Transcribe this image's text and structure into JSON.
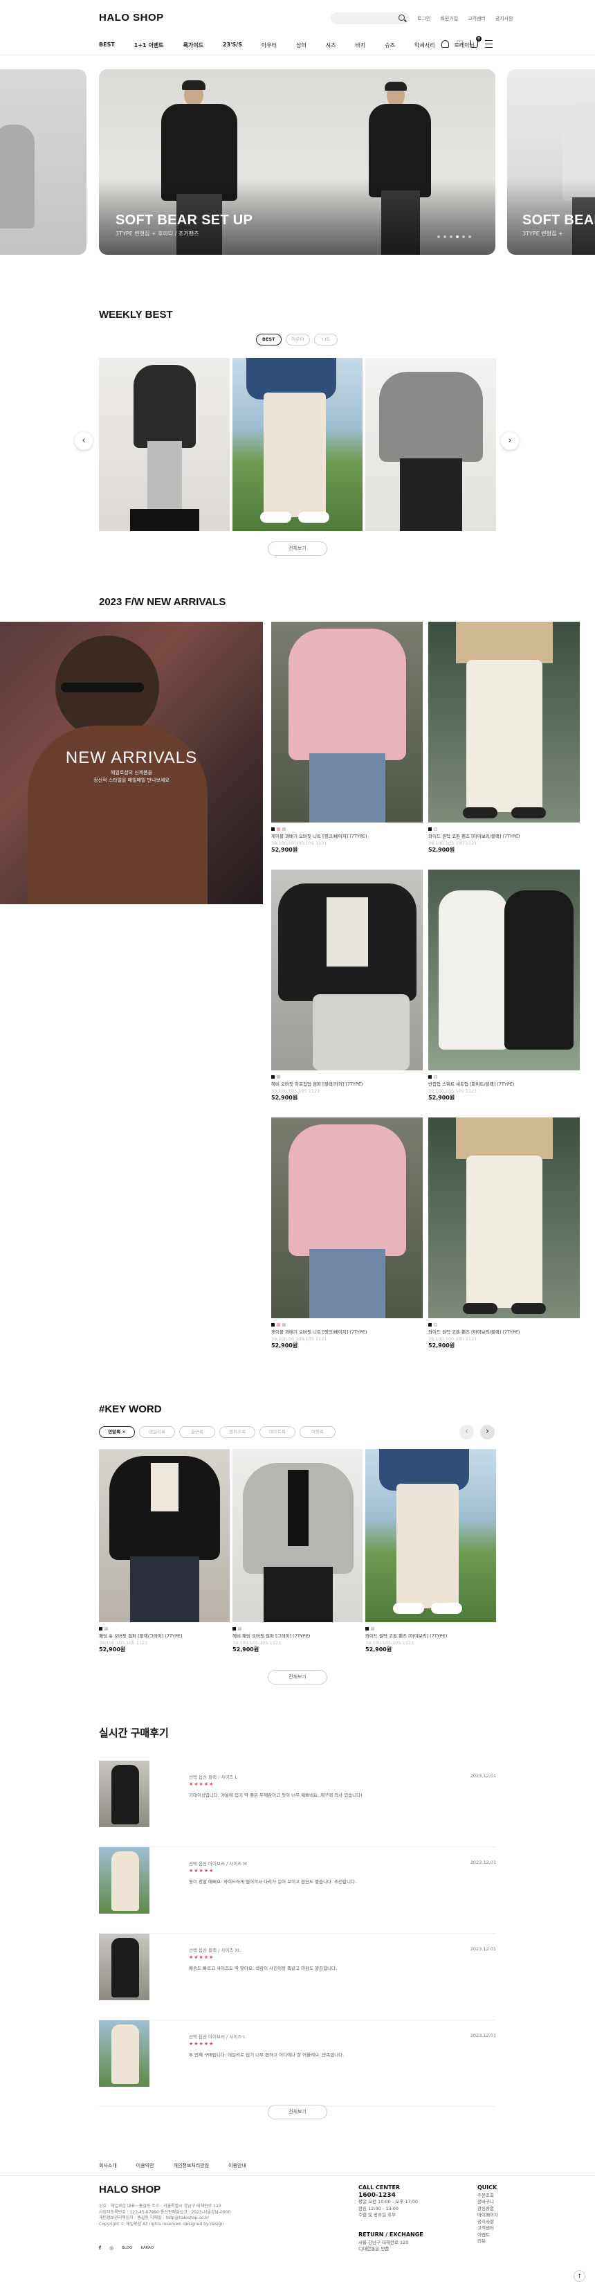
{
  "header": {
    "logo": "HALO SHOP",
    "top_links": [
      "로그인",
      "회원가입",
      "고객센터",
      "공지사항"
    ],
    "gnb": [
      {
        "label": "BEST",
        "style": "bold"
      },
      {
        "label": "1+1 이벤트",
        "style": "bold"
      },
      {
        "label": "룩가이드",
        "style": "bold"
      },
      {
        "label": "23'S/S",
        "style": "bold"
      },
      {
        "label": "아우터",
        "style": "normal"
      },
      {
        "label": "상의",
        "style": "normal"
      },
      {
        "label": "셔츠",
        "style": "normal"
      },
      {
        "label": "바지",
        "style": "normal"
      },
      {
        "label": "슈즈",
        "style": "normal"
      },
      {
        "label": "악세서리",
        "style": "normal"
      },
      {
        "label": "트레이닝",
        "style": "normal"
      }
    ],
    "cart_count": "0"
  },
  "hero": {
    "title": "SOFT BEAR SET UP",
    "subtitle": "3TYPE 변형집 + 후아디 / 조거팬츠",
    "next_title": "SOFT BEAR",
    "next_subtitle": "3TYPE 변형집 +",
    "slide_count": 6,
    "active_slide": 3
  },
  "weekly_best": {
    "title": "WEEKLY BEST",
    "tabs": [
      "BEST",
      "아우터",
      "니트"
    ],
    "active_tab": 0,
    "more": "전체보기"
  },
  "arrivals": {
    "title": "2023 F/W NEW ARRIVALS",
    "banner_title": "NEW ARRIVALS",
    "banner_sub": [
      "헤일로샵의 신제품을",
      "정신적 스타일을 매일매일 만나보세요"
    ],
    "products": [
      {
        "name": "케이블 꽈배기 오버핏 니트 [핑크/베이지] (7TYPE)",
        "old": "39,100,00 105,105 1121",
        "price": "52,900원"
      },
      {
        "name": "와이드 원턱 코튼 팬츠 [아이보리/블랙] (7TYPE)",
        "old": "39,100,105,105 1121",
        "price": "52,900원"
      },
      {
        "name": "헤비 오버핏 하프집업 점퍼 [블랙/카키] (7TYPE)",
        "old": "39,100,105,105 1121",
        "price": "52,900원"
      },
      {
        "name": "반집업 스웨트 세트업 [화이트/블랙] (7TYPE)",
        "old": "39,100,105,105 1121",
        "price": "52,900원"
      },
      {
        "name": "케이블 꽈배기 오버핏 니트 [핑크/베이지] (7TYPE)",
        "old": "39,100,00 105,105 1121",
        "price": "52,900원"
      },
      {
        "name": "와이드 원턱 코튼 팬츠 [아이보리/블랙] (7TYPE)",
        "old": "39,100,105,105 1121",
        "price": "52,900원"
      }
    ]
  },
  "keyword": {
    "title": "#KEY WORD",
    "tags": [
      "연말룩 ×",
      "데일리룩",
      "출근룩",
      "캠퍼스룩",
      "데이트룩",
      "여행룩"
    ],
    "active_tag": 0,
    "products": [
      {
        "name": "패딩 숏 오버핏 점퍼 [블랙/그레이] (7TYPE)",
        "old": "39,100,105,105 1121",
        "price": "52,900원"
      },
      {
        "name": "헤비 패딩 오버핏 점퍼 [그레이] (7TYPE)",
        "old": "39,100,105,105 1121",
        "price": "52,900원"
      },
      {
        "name": "와이드 원턱 코튼 팬츠 [아이보리] (7TYPE)",
        "old": "39,100,105,105 1121",
        "price": "52,900원"
      }
    ],
    "more": "전체보기"
  },
  "reviews": {
    "title": "실시간 구매후기",
    "items": [
      {
        "option": "선택 옵션 블랙 / 사이즈 L",
        "stars": "★★★★★",
        "text": "기대이상입니다. 겨울에 입기 딱 좋은 두께감이고 핏이 너무 예쁘네요. 재구매 의사 있습니다!",
        "date": "2023.12.01"
      },
      {
        "option": "선택 옵션 아이보리 / 사이즈 M",
        "stars": "★★★★★",
        "text": "핏이 정말 예뻐요. 와이드하게 떨어져서 다리가 길어 보이고 원단도 좋습니다. 추천합니다.",
        "date": "2023.12.01"
      },
      {
        "option": "선택 옵션 블랙 / 사이즈 XL",
        "stars": "★★★★★",
        "text": "배송도 빠르고 사이즈도 딱 맞아요. 색감이 사진이랑 똑같고 마감도 깔끔합니다.",
        "date": "2023.12.01"
      },
      {
        "option": "선택 옵션 아이보리 / 사이즈 L",
        "stars": "★★★★★",
        "text": "두 번째 구매입니다. 데일리로 입기 너무 편하고 어디에나 잘 어울려요. 만족합니다.",
        "date": "2023.12.01"
      }
    ],
    "more": "전체보기"
  },
  "footer": {
    "nav": [
      "회사소개",
      "이용약관",
      "개인정보처리방침",
      "이용안내"
    ],
    "logo": "HALO SHOP",
    "info": [
      "상호 : 헤일로샵  대표 : 홍길동  주소 : 서울특별시 강남구 테헤란로 123",
      "사업자등록번호 : 123-45-67890  통신판매업신고 : 2023-서울강남-0000",
      "개인정보관리책임자 : 홍길동  이메일 : help@haloshop.co.kr",
      "Copyright © 헤일로샵 All rights reserved. designed by design"
    ],
    "social": [
      "f",
      "◎",
      "BLOG",
      "KAKAO"
    ],
    "call_center": {
      "label": "CALL CENTER",
      "phone": "1600-1234",
      "lines": [
        "평일 오전 10:00 - 오후 17:00",
        "점심 12:00 - 13:00",
        "주말 및 공휴일 휴무"
      ]
    },
    "return": {
      "label": "RETURN / EXCHANGE",
      "lines": [
        "서울 강남구 테헤란로 123",
        "CJ대한통운 반품"
      ]
    },
    "quick": {
      "label": "QUICK",
      "links": [
        "주문조회",
        "장바구니",
        "관심상품",
        "마이페이지",
        "공지사항",
        "고객센터",
        "이벤트",
        "리뷰"
      ]
    }
  },
  "top_button": "↑",
  "colors": {
    "accent": "#111111",
    "star": "#e0445a",
    "border": "#e5e5e5"
  }
}
